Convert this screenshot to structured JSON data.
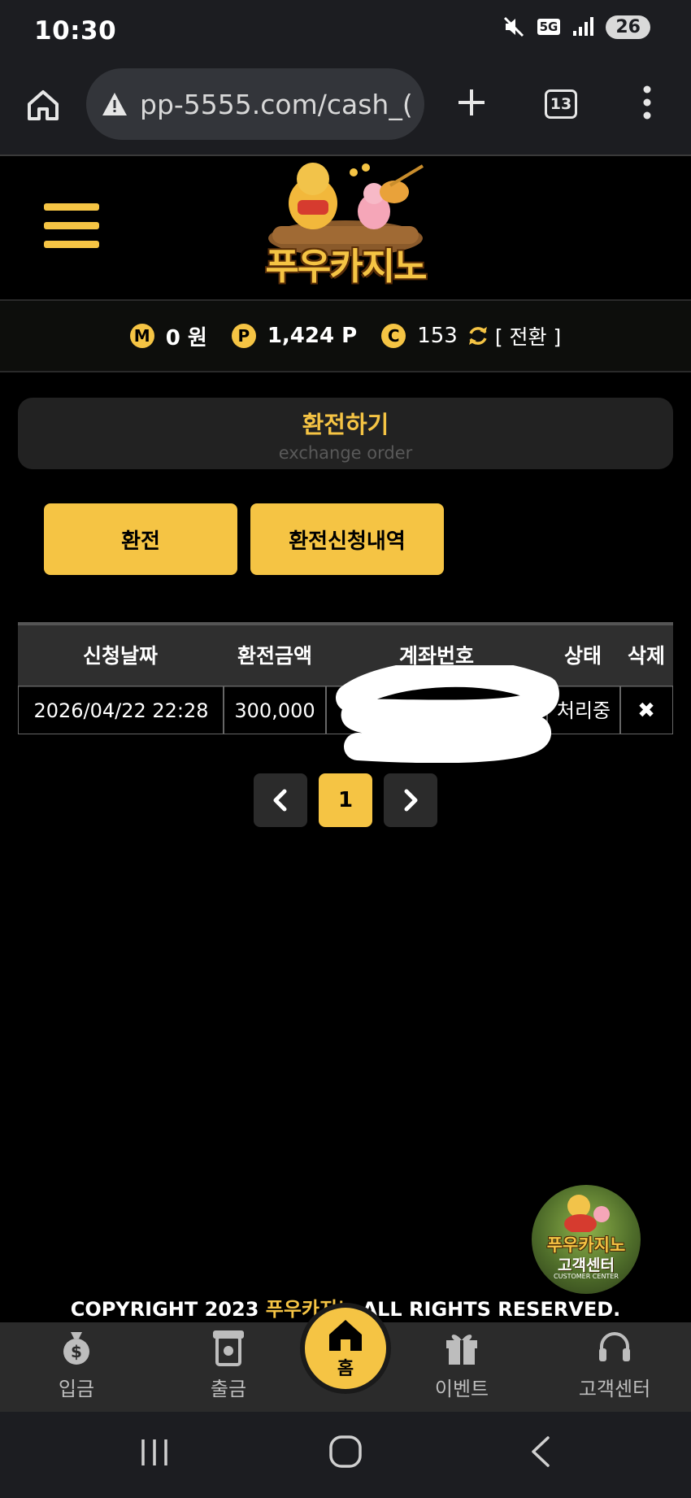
{
  "status_bar": {
    "time": "10:30",
    "network": "5G",
    "battery": "26"
  },
  "browser": {
    "url": "pp-5555.com/cash_(",
    "tab_count": "13"
  },
  "site": {
    "logo_text": "푸우카지노"
  },
  "balance": {
    "money_icon": "M",
    "money": "0 원",
    "point_icon": "P",
    "points": "1,424 P",
    "coin_icon": "C",
    "coins": "153",
    "convert_label": "[ 전환 ]"
  },
  "exchange": {
    "title": "환전하기",
    "subtitle": "exchange order",
    "exchange_button": "환전",
    "history_button": "환전신청내역"
  },
  "table": {
    "headers": [
      "신청날짜",
      "환전금액",
      "계좌번호",
      "상태",
      "삭제"
    ],
    "rows": [
      {
        "date": "2026/04/22 22:28",
        "amount": "300,000",
        "account": "",
        "status": "처리중",
        "delete": "✖"
      }
    ]
  },
  "pagination": {
    "current_page": "1"
  },
  "customer_center": {
    "line1": "푸우카지노",
    "line2": "고객센터",
    "line3": "CUSTOMER CENTER"
  },
  "footer": {
    "copyright_prefix": "COPYRIGHT 2023 ",
    "copyright_brand": "푸우카지노",
    "copyright_suffix": " ALL RIGHTS RESERVED."
  },
  "bottom_nav": {
    "deposit": "입금",
    "withdraw": "출금",
    "home": "홈",
    "event": "이벤트",
    "support": "고객센터"
  },
  "colors": {
    "accent": "#f5c444",
    "background": "#000000",
    "panel": "#222222"
  }
}
